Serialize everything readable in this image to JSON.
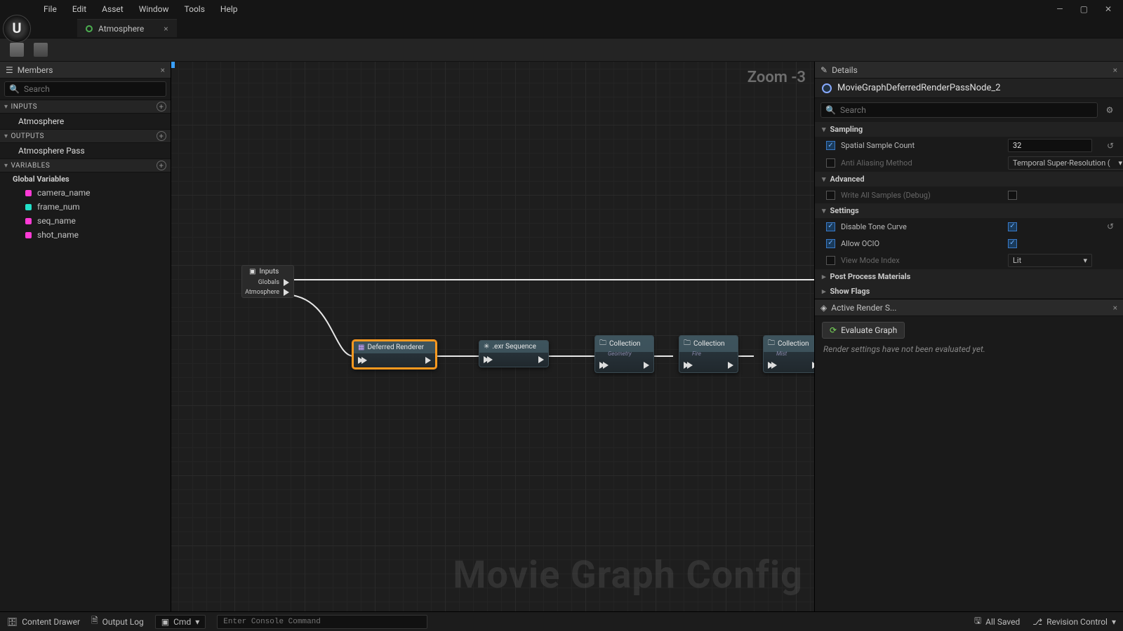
{
  "menu": {
    "file": "File",
    "edit": "Edit",
    "asset": "Asset",
    "window": "Window",
    "tools": "Tools",
    "help": "Help"
  },
  "tab": {
    "name": "Atmosphere"
  },
  "left": {
    "panel_title": "Members",
    "search_placeholder": "Search",
    "inputs_header": "INPUTS",
    "inputs": [
      {
        "label": "Atmosphere"
      }
    ],
    "outputs_header": "OUTPUTS",
    "outputs": [
      {
        "label": "Atmosphere Pass"
      }
    ],
    "variables_header": "VARIABLES",
    "globals_header": "Global Variables",
    "globals": [
      {
        "label": "camera_name",
        "color": "magenta"
      },
      {
        "label": "frame_num",
        "color": "cyan"
      },
      {
        "label": "seq_name",
        "color": "magenta"
      },
      {
        "label": "shot_name",
        "color": "magenta"
      }
    ]
  },
  "graph": {
    "zoom": "Zoom -3",
    "watermark": "Movie Graph Config",
    "inputs_node": {
      "title": "Inputs",
      "pins": [
        "Globals",
        "Atmosphere"
      ]
    },
    "nodes": [
      {
        "title": "Deferred Renderer",
        "sub": "",
        "selected": true
      },
      {
        "title": ".exr Sequence",
        "sub": ""
      },
      {
        "title": "Collection",
        "sub": "Geometry"
      },
      {
        "title": "Collection",
        "sub": "Fire"
      },
      {
        "title": "Collection",
        "sub": "Mist"
      }
    ]
  },
  "details": {
    "panel_title": "Details",
    "object": "MovieGraphDeferredRenderPassNode_2",
    "search_placeholder": "Search",
    "cat_sampling": "Sampling",
    "spatial_sample_label": "Spatial Sample Count",
    "spatial_sample_value": "32",
    "aa_label": "Anti Aliasing Method",
    "aa_value": "Temporal Super-Resolution (",
    "cat_advanced": "Advanced",
    "write_samples_label": "Write All Samples (Debug)",
    "cat_settings": "Settings",
    "disable_tone_label": "Disable Tone Curve",
    "allow_ocio_label": "Allow OCIO",
    "viewmode_label": "View Mode Index",
    "viewmode_value": "Lit",
    "cat_ppm": "Post Process Materials",
    "cat_showflags": "Show Flags"
  },
  "active": {
    "panel_title": "Active Render S...",
    "button": "Evaluate Graph",
    "message": "Render settings have not been evaluated yet."
  },
  "status": {
    "content_drawer": "Content Drawer",
    "output_log": "Output Log",
    "cmd": "Cmd",
    "console_placeholder": "Enter Console Command",
    "all_saved": "All Saved",
    "revision": "Revision Control"
  }
}
